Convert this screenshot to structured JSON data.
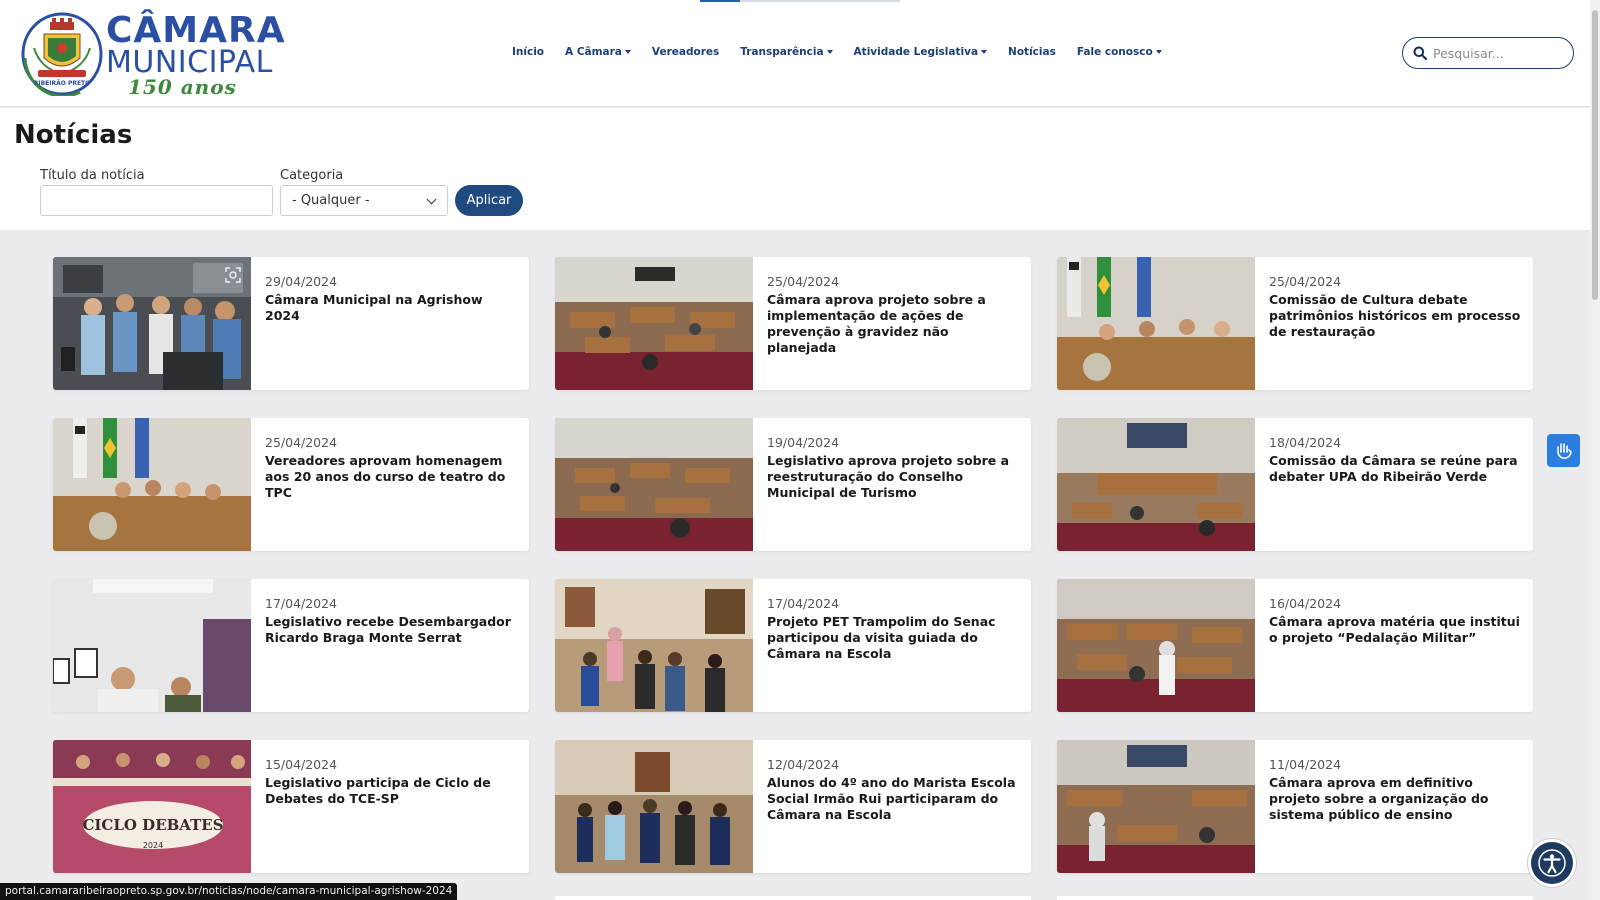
{
  "logo": {
    "line1": "CÂMARA",
    "line2": "MUNICIPAL",
    "line3": "150 anos",
    "seal_text": "RIBEIRÃO PRETO"
  },
  "nav": {
    "items": [
      {
        "label": "Início",
        "dropdown": false
      },
      {
        "label": "A Câmara",
        "dropdown": true
      },
      {
        "label": "Vereadores",
        "dropdown": false
      },
      {
        "label": "Transparência",
        "dropdown": true
      },
      {
        "label": "Atividade Legislativa",
        "dropdown": true
      },
      {
        "label": "Notícias",
        "dropdown": false
      },
      {
        "label": "Fale conosco",
        "dropdown": true
      }
    ]
  },
  "search": {
    "placeholder": "Pesquisar..."
  },
  "page": {
    "title": "Notícias"
  },
  "filters": {
    "title_label": "Título da notícia",
    "title_value": "",
    "category_label": "Categoria",
    "category_selected": "- Qualquer -",
    "apply_label": "Aplicar"
  },
  "news": [
    {
      "date": "29/04/2024",
      "title": "Câmara Municipal na Agrishow 2024",
      "thumb": "group-photo"
    },
    {
      "date": "25/04/2024",
      "title": "Câmara aprova projeto sobre a implementação de ações de prevenção à gravidez não planejada",
      "thumb": "plenary"
    },
    {
      "date": "25/04/2024",
      "title": "Comissão de Cultura debate patrimônios históricos em processo de restauração",
      "thumb": "committee"
    },
    {
      "date": "25/04/2024",
      "title": "Vereadores aprovam homenagem aos 20 anos do curso de teatro do TPC",
      "thumb": "committee"
    },
    {
      "date": "19/04/2024",
      "title": "Legislativo aprova projeto sobre a reestruturação do Conselho Municipal de Turismo",
      "thumb": "plenary"
    },
    {
      "date": "18/04/2024",
      "title": "Comissão da Câmara se reúne para debater UPA do Ribeirão Verde",
      "thumb": "committee"
    },
    {
      "date": "17/04/2024",
      "title": "Legislativo recebe Desembargador Ricardo Braga Monte Serrat",
      "thumb": "office"
    },
    {
      "date": "17/04/2024",
      "title": "Projeto PET Trampolim do Senac participou da visita guiada do Câmara na Escola",
      "thumb": "visit"
    },
    {
      "date": "16/04/2024",
      "title": "Câmara aprova matéria que institui o projeto “Pedalação Militar”",
      "thumb": "plenary"
    },
    {
      "date": "15/04/2024",
      "title": "Legislativo participa de Ciclo de Debates do TCE-SP",
      "thumb": "debates",
      "thumb_text": "CICLO DEBATES",
      "thumb_year": "2024"
    },
    {
      "date": "12/04/2024",
      "title": "Alunos do 4º ano do Marista Escola Social Irmão Rui participaram do Câmara na Escola",
      "thumb": "visit"
    },
    {
      "date": "11/04/2024",
      "title": "Câmara aprova em definitivo projeto sobre a organização do sistema público de ensino",
      "thumb": "plenary"
    }
  ],
  "status_url": "portal.camararibeiraopreto.sp.gov.br/noticias/node/camara-municipal-agrishow-2024",
  "colors": {
    "brand_blue": "#2b4fa3",
    "nav_blue": "#1c3f77",
    "apply_bg": "#1f4a80",
    "accent_green": "#3d8a3a"
  },
  "icons": {
    "search": "search-icon",
    "libras": "sign-language-icon",
    "accessibility": "accessibility-icon",
    "zoom": "image-zoom-icon"
  }
}
